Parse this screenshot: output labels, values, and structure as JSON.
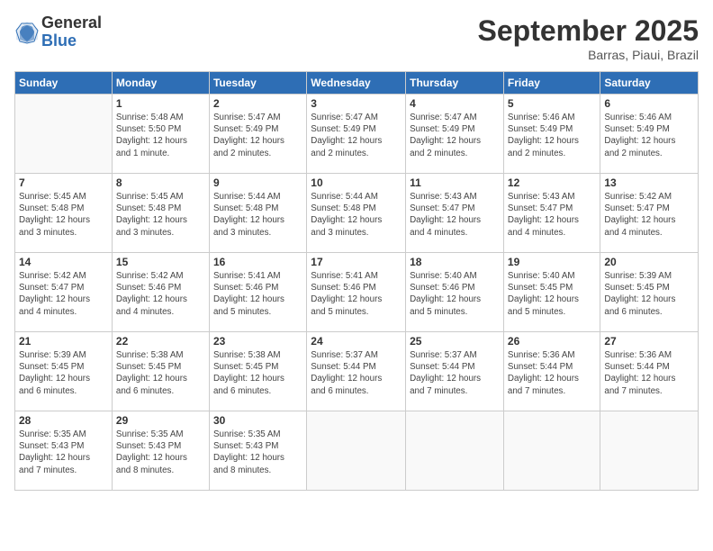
{
  "logo": {
    "general": "General",
    "blue": "Blue"
  },
  "title": "September 2025",
  "location": "Barras, Piaui, Brazil",
  "days_header": [
    "Sunday",
    "Monday",
    "Tuesday",
    "Wednesday",
    "Thursday",
    "Friday",
    "Saturday"
  ],
  "weeks": [
    [
      {
        "day": "",
        "info": ""
      },
      {
        "day": "1",
        "info": "Sunrise: 5:48 AM\nSunset: 5:50 PM\nDaylight: 12 hours\nand 1 minute."
      },
      {
        "day": "2",
        "info": "Sunrise: 5:47 AM\nSunset: 5:49 PM\nDaylight: 12 hours\nand 2 minutes."
      },
      {
        "day": "3",
        "info": "Sunrise: 5:47 AM\nSunset: 5:49 PM\nDaylight: 12 hours\nand 2 minutes."
      },
      {
        "day": "4",
        "info": "Sunrise: 5:47 AM\nSunset: 5:49 PM\nDaylight: 12 hours\nand 2 minutes."
      },
      {
        "day": "5",
        "info": "Sunrise: 5:46 AM\nSunset: 5:49 PM\nDaylight: 12 hours\nand 2 minutes."
      },
      {
        "day": "6",
        "info": "Sunrise: 5:46 AM\nSunset: 5:49 PM\nDaylight: 12 hours\nand 2 minutes."
      }
    ],
    [
      {
        "day": "7",
        "info": "Sunrise: 5:45 AM\nSunset: 5:48 PM\nDaylight: 12 hours\nand 3 minutes."
      },
      {
        "day": "8",
        "info": "Sunrise: 5:45 AM\nSunset: 5:48 PM\nDaylight: 12 hours\nand 3 minutes."
      },
      {
        "day": "9",
        "info": "Sunrise: 5:44 AM\nSunset: 5:48 PM\nDaylight: 12 hours\nand 3 minutes."
      },
      {
        "day": "10",
        "info": "Sunrise: 5:44 AM\nSunset: 5:48 PM\nDaylight: 12 hours\nand 3 minutes."
      },
      {
        "day": "11",
        "info": "Sunrise: 5:43 AM\nSunset: 5:47 PM\nDaylight: 12 hours\nand 4 minutes."
      },
      {
        "day": "12",
        "info": "Sunrise: 5:43 AM\nSunset: 5:47 PM\nDaylight: 12 hours\nand 4 minutes."
      },
      {
        "day": "13",
        "info": "Sunrise: 5:42 AM\nSunset: 5:47 PM\nDaylight: 12 hours\nand 4 minutes."
      }
    ],
    [
      {
        "day": "14",
        "info": "Sunrise: 5:42 AM\nSunset: 5:47 PM\nDaylight: 12 hours\nand 4 minutes."
      },
      {
        "day": "15",
        "info": "Sunrise: 5:42 AM\nSunset: 5:46 PM\nDaylight: 12 hours\nand 4 minutes."
      },
      {
        "day": "16",
        "info": "Sunrise: 5:41 AM\nSunset: 5:46 PM\nDaylight: 12 hours\nand 5 minutes."
      },
      {
        "day": "17",
        "info": "Sunrise: 5:41 AM\nSunset: 5:46 PM\nDaylight: 12 hours\nand 5 minutes."
      },
      {
        "day": "18",
        "info": "Sunrise: 5:40 AM\nSunset: 5:46 PM\nDaylight: 12 hours\nand 5 minutes."
      },
      {
        "day": "19",
        "info": "Sunrise: 5:40 AM\nSunset: 5:45 PM\nDaylight: 12 hours\nand 5 minutes."
      },
      {
        "day": "20",
        "info": "Sunrise: 5:39 AM\nSunset: 5:45 PM\nDaylight: 12 hours\nand 6 minutes."
      }
    ],
    [
      {
        "day": "21",
        "info": "Sunrise: 5:39 AM\nSunset: 5:45 PM\nDaylight: 12 hours\nand 6 minutes."
      },
      {
        "day": "22",
        "info": "Sunrise: 5:38 AM\nSunset: 5:45 PM\nDaylight: 12 hours\nand 6 minutes."
      },
      {
        "day": "23",
        "info": "Sunrise: 5:38 AM\nSunset: 5:45 PM\nDaylight: 12 hours\nand 6 minutes."
      },
      {
        "day": "24",
        "info": "Sunrise: 5:37 AM\nSunset: 5:44 PM\nDaylight: 12 hours\nand 6 minutes."
      },
      {
        "day": "25",
        "info": "Sunrise: 5:37 AM\nSunset: 5:44 PM\nDaylight: 12 hours\nand 7 minutes."
      },
      {
        "day": "26",
        "info": "Sunrise: 5:36 AM\nSunset: 5:44 PM\nDaylight: 12 hours\nand 7 minutes."
      },
      {
        "day": "27",
        "info": "Sunrise: 5:36 AM\nSunset: 5:44 PM\nDaylight: 12 hours\nand 7 minutes."
      }
    ],
    [
      {
        "day": "28",
        "info": "Sunrise: 5:35 AM\nSunset: 5:43 PM\nDaylight: 12 hours\nand 7 minutes."
      },
      {
        "day": "29",
        "info": "Sunrise: 5:35 AM\nSunset: 5:43 PM\nDaylight: 12 hours\nand 8 minutes."
      },
      {
        "day": "30",
        "info": "Sunrise: 5:35 AM\nSunset: 5:43 PM\nDaylight: 12 hours\nand 8 minutes."
      },
      {
        "day": "",
        "info": ""
      },
      {
        "day": "",
        "info": ""
      },
      {
        "day": "",
        "info": ""
      },
      {
        "day": "",
        "info": ""
      }
    ]
  ]
}
